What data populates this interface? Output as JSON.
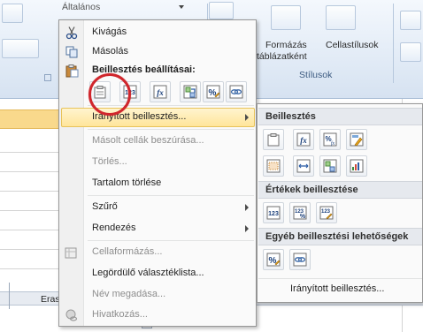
{
  "ribbon": {
    "alignment_text": "Általános",
    "format_as_table": "Formázás",
    "format_as_table_line2": "táblázatként",
    "cell_styles": "Cellastílusok",
    "styles_group": "Stílusok"
  },
  "sheet": {
    "partial_cell": "Eras"
  },
  "context_menu": {
    "cut": "Kivágás",
    "copy": "Másolás",
    "paste_options_header": "Beillesztés beállításai:",
    "paste_special": "Irányított beillesztés...",
    "insert_copied": "Másolt cellák beszúrása...",
    "delete": "Törlés...",
    "clear_contents": "Tartalom törlése",
    "filter": "Szűrő",
    "sort": "Rendezés",
    "format_cells": "Cellaformázás...",
    "pick_list": "Legördülő választéklista...",
    "define_name": "Név megadása...",
    "hyperlink": "Hivatkozás..."
  },
  "paste_buttons": {
    "values_label": "123",
    "formula_label": "fx"
  },
  "submenu": {
    "paste_header": "Beillesztés",
    "values_header": "Értékek beillesztése",
    "other_header": "Egyéb beillesztési lehetőségek",
    "paste_special_link": "Irányított beillesztés...",
    "values_label": "123"
  },
  "colors": {
    "highlight": "#ffe59a",
    "annotation_circle": "#d0262c",
    "selected_column_header": "#f9d98c"
  }
}
